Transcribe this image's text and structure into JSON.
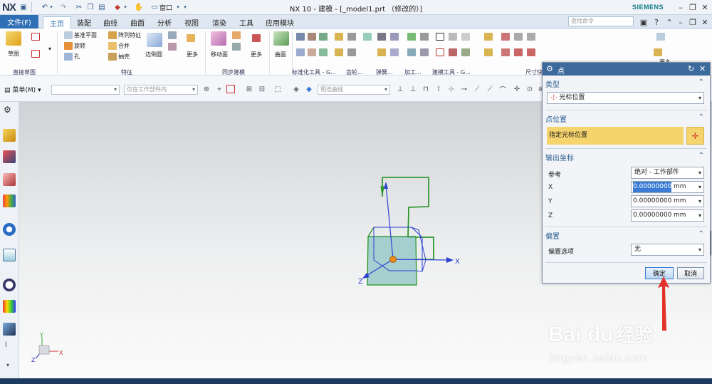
{
  "titlebar": {
    "logo": "NX",
    "title": "NX 10 - 建模 - [_model1.prt （修改的）]",
    "window_menu": "窗口",
    "brand": "SIEMENS"
  },
  "menubar": {
    "file_tab": "文件(F)",
    "tabs": [
      "主页",
      "装配",
      "曲线",
      "曲面",
      "分析",
      "视图",
      "渲染",
      "工具",
      "应用模块"
    ],
    "search_placeholder": "查找命令"
  },
  "ribbon": {
    "groups": {
      "sketch": "直接草图",
      "feature": "特征",
      "sync": "同步建模",
      "std": "标准化工具 - G...",
      "gear": "齿轮...",
      "spring": "弹簧...",
      "mach": "加工...",
      "modtool": "建模工具 - G...",
      "dim": "尺寸快..."
    },
    "sketch_label": "草图",
    "datum_plane": "基准平面",
    "pattern_feature": "阵列特征",
    "revolve": "旋转",
    "unite": "合并",
    "hole": "孔",
    "shell": "抽壳",
    "edge_blend": "边倒圆",
    "more1": "更多",
    "move_face": "移动面",
    "more2": "更多",
    "surface": "曲面",
    "more3": "更多"
  },
  "toolbar2": {
    "menu_label": "菜单(M)",
    "filter_scope": "仅在工作部件内",
    "curve_rule": "相连曲线"
  },
  "viewport": {
    "axis_x": "X",
    "axis_y": "Y",
    "axis_z": "Z",
    "triad_x": "X",
    "triad_y": "Y",
    "triad_z": "Z"
  },
  "dialog": {
    "title": "点",
    "type_section": "类型",
    "type_value": "光标位置",
    "point_location_section": "点位置",
    "specify_cursor_location": "指定光标位置",
    "output_coords_section": "输出坐标",
    "reference_label": "参考",
    "reference_value": "绝对 - 工作部件",
    "x_label": "X",
    "x_value": "0.0000000000",
    "y_label": "Y",
    "y_value": "0.0000000000",
    "z_label": "Z",
    "z_value": "0.0000000000",
    "unit": "mm",
    "offset_section": "偏置",
    "offset_option_label": "偏置选项",
    "offset_option_value": "无",
    "ok_label": "确定",
    "cancel_label": "取消"
  },
  "watermark": {
    "brand": "Bai du",
    "brand_cn": "经验",
    "url": "jingyan.baidu.com"
  },
  "colors": {
    "accent": "#2f6fb5",
    "dialog_title": "#3d6a9c",
    "highlight_row": "#f6d46d",
    "model_green": "#1a8f1a",
    "model_blue": "#2d3fd3",
    "model_teal": "#8cc4c4",
    "arrow_red": "#e3322a"
  }
}
